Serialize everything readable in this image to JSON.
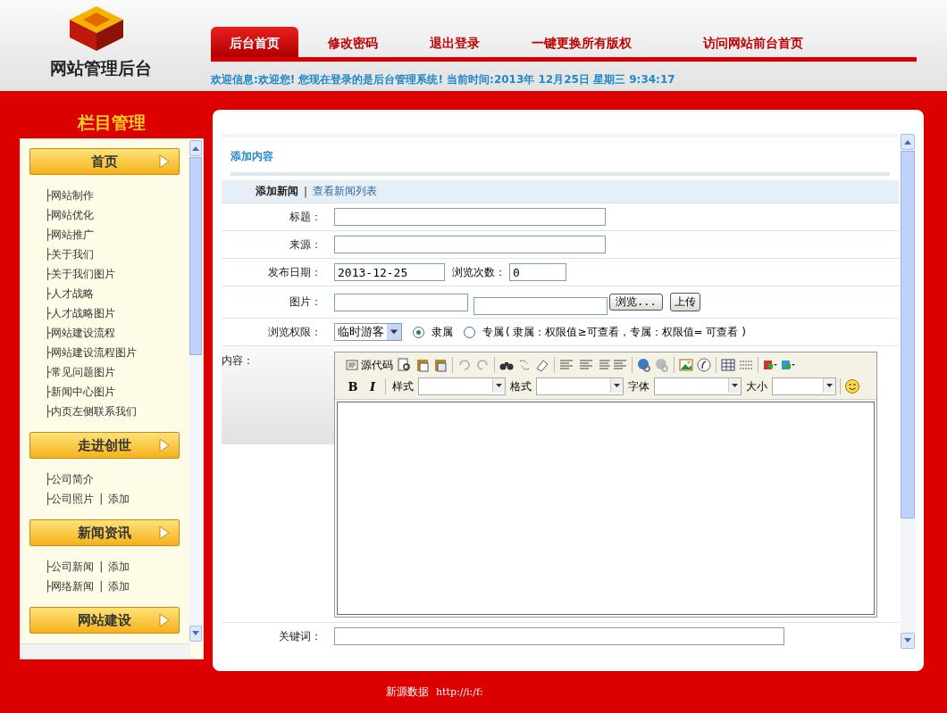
{
  "header": {
    "logo_text": "网站管理后台",
    "nav": [
      {
        "label": "后台首页",
        "selected": true
      },
      {
        "label": "修改密码",
        "selected": false
      },
      {
        "label": "退出登录",
        "selected": false
      },
      {
        "label": "一键更换所有版权",
        "selected": false
      },
      {
        "label": "访问网站前台首页",
        "selected": false
      }
    ],
    "welcome": "欢迎信息:欢迎您! 您现在登录的是后台管理系统! 当前时间:2013年 12月25日 星期三 9:34:17"
  },
  "sidebar": {
    "title": "栏目管理",
    "groups": [
      {
        "title": "首页",
        "items": [
          {
            "label": "├网站制作"
          },
          {
            "label": "├网站优化"
          },
          {
            "label": "├网站推广"
          },
          {
            "label": "├关于我们"
          },
          {
            "label": "├关于我们图片"
          },
          {
            "label": "├人才战略"
          },
          {
            "label": "├人才战略图片"
          },
          {
            "label": "├网站建设流程"
          },
          {
            "label": "├网站建设流程图片"
          },
          {
            "label": "├常见问题图片"
          },
          {
            "label": "├新闻中心图片"
          },
          {
            "label": "├内页左侧联系我们"
          }
        ]
      },
      {
        "title": "走进创世",
        "items": [
          {
            "label": "├公司简介"
          },
          {
            "label": "├公司照片",
            "separator": "|",
            "add": "添加"
          }
        ]
      },
      {
        "title": "新闻资讯",
        "items": [
          {
            "label": "├公司新闻",
            "separator": "|",
            "add": "添加"
          },
          {
            "label": "├网络新闻",
            "separator": "|",
            "add": "添加"
          }
        ]
      },
      {
        "title": "网站建设"
      }
    ]
  },
  "main": {
    "title": "添加内容",
    "subnav": [
      {
        "label": "添加新闻",
        "selected": true
      },
      {
        "label": "查看新闻列表",
        "selected": false
      }
    ],
    "subnav_separator": "|",
    "form": {
      "title_label": "标题：",
      "source_label": "来源：",
      "date_label": "发布日期：",
      "date_value": "2013-12-25",
      "views_label": "浏览次数：",
      "views_value": "0",
      "image_label": "图片：",
      "browse_button": "浏览...",
      "upload_button": "上传",
      "permission_label": "浏览权限：",
      "permission_value": "临时游客",
      "radios": [
        {
          "label": "隶属",
          "selected": true
        },
        {
          "label": "专属",
          "selected": false
        }
      ],
      "permission_note": "( 隶属：权限值≥可查看，专属：权限值= 可查看 )",
      "content_label": "内容：",
      "editor": {
        "source_button": "源代码",
        "bold": "B",
        "italic": "I",
        "selects": [
          {
            "label": "样式"
          },
          {
            "label": "格式"
          },
          {
            "label": "字体"
          },
          {
            "label": "大小"
          }
        ]
      },
      "keywords_label": "关键词："
    }
  },
  "footer": {
    "company": "新源数据",
    "url": "http://i:/f:"
  }
}
